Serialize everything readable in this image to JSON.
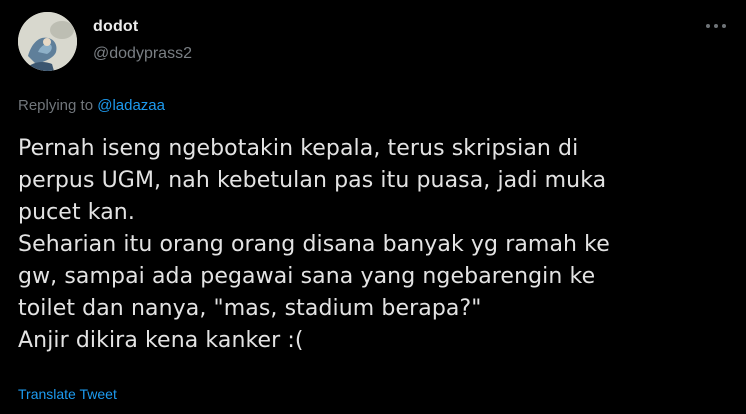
{
  "author": {
    "display_name": "dodot",
    "handle": "@dodyprass2",
    "avatar_icon": "profile-avatar"
  },
  "menu": {
    "icon": "more-options-icon"
  },
  "reply": {
    "prefix": "Replying to ",
    "mention": "@ladazaa"
  },
  "tweet": {
    "lines": [
      "Pernah iseng ngebotakin kepala, terus skripsian di",
      "perpus UGM, nah kebetulan pas itu puasa, jadi muka",
      "pucet kan.",
      "Seharian itu orang orang disana banyak yg ramah ke",
      "gw, sampai ada pegawai sana yang ngebarengin ke",
      "toilet dan nanya, \"mas, stadium berapa?\"",
      "Anjir dikira kena kanker :("
    ]
  },
  "actions": {
    "translate_label": "Translate Tweet"
  },
  "colors": {
    "background": "#000000",
    "text": "#e3e3e3",
    "secondary": "#71767b",
    "accent": "#1d9bf0"
  }
}
